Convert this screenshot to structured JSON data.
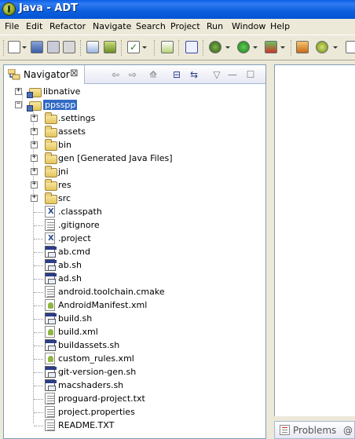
{
  "window": {
    "title": "Java - ADT"
  },
  "menu": [
    "File",
    "Edit",
    "Refactor",
    "Navigate",
    "Search",
    "Project",
    "Run",
    "Window",
    "Help"
  ],
  "toolbar": {
    "icons": [
      "new-icon",
      "save-icon",
      "save-all-icon",
      "print-icon",
      "import-icon",
      "android-sdk-icon",
      "checkbox-icon",
      "android-avd-icon",
      "lint-icon",
      "debug-icon",
      "run-icon",
      "external-tools-icon",
      "new-java-class-icon",
      "refresh-icon"
    ]
  },
  "navigator": {
    "tab_label": "Navigator",
    "close_glyph": "⊠",
    "back_glyph": "⇦",
    "forward_glyph": "⇨",
    "up_glyph": "⟰",
    "collapse_glyph": "⊟",
    "link_glyph": "⇆",
    "menu_glyph": "▽",
    "minimize_glyph": "—",
    "maximize_glyph": "☐",
    "tree": [
      {
        "label": "libnative",
        "kind": "project",
        "level": 0,
        "expander": "+"
      },
      {
        "label": "ppsspp",
        "kind": "project",
        "level": 0,
        "expander": "−",
        "selected": true
      },
      {
        "label": ".settings",
        "kind": "folder",
        "level": 1,
        "expander": "+"
      },
      {
        "label": "assets",
        "kind": "folder",
        "level": 1,
        "expander": "+"
      },
      {
        "label": "bin",
        "kind": "folder",
        "level": 1,
        "expander": "+"
      },
      {
        "label": "gen [Generated Java Files]",
        "kind": "folder",
        "level": 1,
        "expander": "+"
      },
      {
        "label": "jni",
        "kind": "folder",
        "level": 1,
        "expander": "+"
      },
      {
        "label": "res",
        "kind": "folder",
        "level": 1,
        "expander": "+"
      },
      {
        "label": "src",
        "kind": "folder",
        "level": 1,
        "expander": "+"
      },
      {
        "label": ".classpath",
        "kind": "xml",
        "level": 1
      },
      {
        "label": ".gitignore",
        "kind": "text",
        "level": 1
      },
      {
        "label": ".project",
        "kind": "xml",
        "level": 1
      },
      {
        "label": "ab.cmd",
        "kind": "script",
        "level": 1
      },
      {
        "label": "ab.sh",
        "kind": "script",
        "level": 1
      },
      {
        "label": "ad.sh",
        "kind": "script",
        "level": 1
      },
      {
        "label": "android.toolchain.cmake",
        "kind": "text",
        "level": 1
      },
      {
        "label": "AndroidManifest.xml",
        "kind": "android",
        "level": 1
      },
      {
        "label": "build.sh",
        "kind": "script",
        "level": 1
      },
      {
        "label": "build.xml",
        "kind": "android",
        "level": 1
      },
      {
        "label": "buildassets.sh",
        "kind": "script",
        "level": 1
      },
      {
        "label": "custom_rules.xml",
        "kind": "android",
        "level": 1
      },
      {
        "label": "git-version-gen.sh",
        "kind": "script",
        "level": 1
      },
      {
        "label": "macshaders.sh",
        "kind": "script",
        "level": 1
      },
      {
        "label": "proguard-project.txt",
        "kind": "text",
        "level": 1
      },
      {
        "label": "project.properties",
        "kind": "text",
        "level": 1
      },
      {
        "label": "README.TXT",
        "kind": "text",
        "level": 1
      }
    ]
  },
  "bottom_panel": {
    "problems_label": "Problems",
    "next_tab_label": "@"
  }
}
